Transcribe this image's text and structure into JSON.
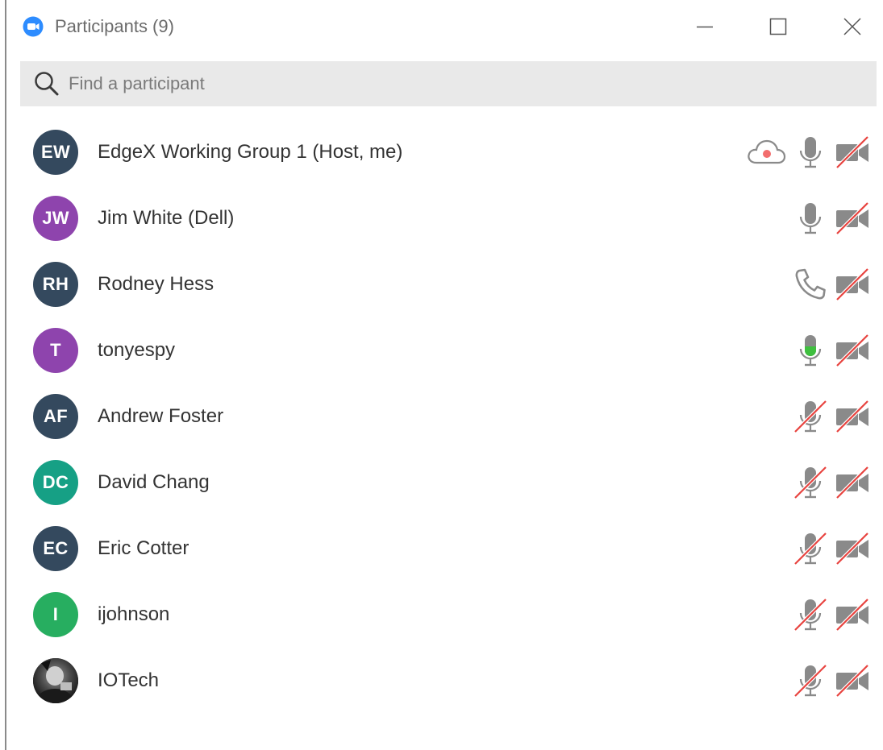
{
  "window": {
    "title": "Participants (9)"
  },
  "search": {
    "placeholder": "Find a participant"
  },
  "colors": {
    "navy": "#34495e",
    "purple": "#8e44ad",
    "teal": "#16a085",
    "green": "#27ae60",
    "icon_gray": "#8a8a8a",
    "slash_red": "#e8433f",
    "speaking_green": "#3fbf3f"
  },
  "participants": [
    {
      "initials": "EW",
      "name": "EdgeX Working Group 1 (Host, me)",
      "avatar_color": "#34495e",
      "audio": "mic-on",
      "video": "video-off",
      "recording": true
    },
    {
      "initials": "JW",
      "name": "Jim White (Dell)",
      "avatar_color": "#8e44ad",
      "audio": "mic-on",
      "video": "video-off",
      "recording": false
    },
    {
      "initials": "RH",
      "name": "Rodney Hess",
      "avatar_color": "#34495e",
      "audio": "phone",
      "video": "video-off",
      "recording": false
    },
    {
      "initials": "T",
      "name": "tonyespy",
      "avatar_color": "#8e44ad",
      "audio": "mic-speaking",
      "video": "video-off",
      "recording": false
    },
    {
      "initials": "AF",
      "name": "Andrew Foster",
      "avatar_color": "#34495e",
      "audio": "mic-muted",
      "video": "video-off",
      "recording": false
    },
    {
      "initials": "DC",
      "name": "David Chang",
      "avatar_color": "#16a085",
      "audio": "mic-muted",
      "video": "video-off",
      "recording": false
    },
    {
      "initials": "EC",
      "name": "Eric Cotter",
      "avatar_color": "#34495e",
      "audio": "mic-muted",
      "video": "video-off",
      "recording": false
    },
    {
      "initials": "I",
      "name": "ijohnson",
      "avatar_color": "#27ae60",
      "audio": "mic-muted",
      "video": "video-off",
      "recording": false
    },
    {
      "initials": "",
      "name": "IOTech",
      "avatar_color": "#2b2b2b",
      "audio": "mic-muted",
      "video": "video-off",
      "recording": false,
      "photo": true
    }
  ]
}
